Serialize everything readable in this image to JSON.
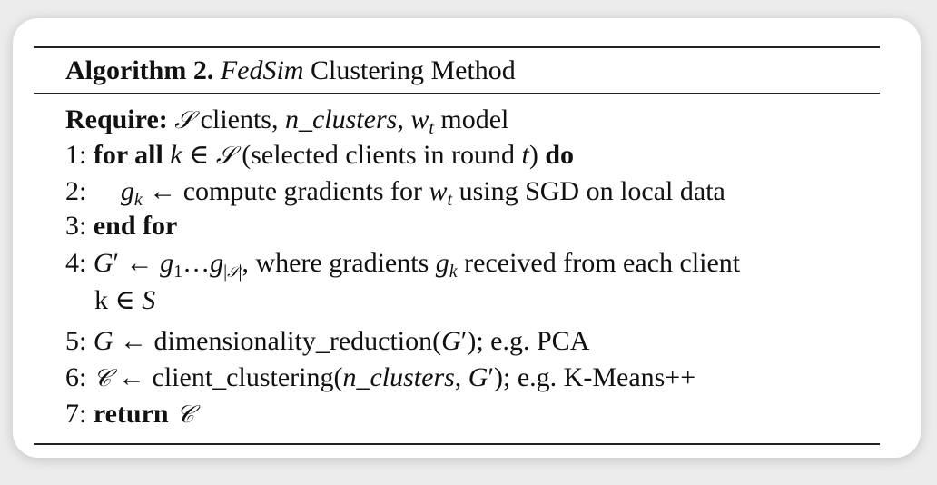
{
  "algorithm": {
    "label": "Algorithm 2.",
    "name": "FedSim",
    "title_rest": "Clustering Method"
  },
  "require": {
    "keyword": "Require:",
    "set_symbol": "𝒮",
    "text_clients": " clients, ",
    "param": "n_clusters",
    "comma": ", ",
    "w": "w",
    "w_sub": "t",
    "text_model": " model"
  },
  "lines": {
    "l1": {
      "num": "1: ",
      "kw_for": "for all",
      "k": " k ",
      "in": "∈ ",
      "set": "𝒮",
      "paren_open": " (selected clients in round ",
      "t": "t",
      "paren_close": ") ",
      "kw_do": "do"
    },
    "l2": {
      "num": "2: ",
      "g": "g",
      "g_sub": "k",
      "arrow_text": " ← compute gradients for ",
      "w": "w",
      "w_sub": "t",
      "rest": " using SGD on local data"
    },
    "l3": {
      "num": "3: ",
      "kw": "end for"
    },
    "l4": {
      "num": "4: ",
      "G": "G",
      "prime": "′",
      "arrow": " ← ",
      "g1": "g",
      "g1_sub": "1",
      "dots": "…",
      "g2": "g",
      "g2_sub_open": "|",
      "g2_sub_set": "𝒮",
      "g2_sub_close": "|",
      "mid": ", where gradients ",
      "gk": "g",
      "gk_sub": "k",
      "rest": " received from each client",
      "cont": "k ∈ ",
      "cont_S": "S"
    },
    "l5": {
      "num": "5: ",
      "G": "G",
      "text": " ← dimensionality_reduction(",
      "Gp": "G",
      "prime": "′",
      "rest": "); e.g. PCA"
    },
    "l6": {
      "num": "6: ",
      "C": "𝒞",
      "text": " ← client_clustering(",
      "param": "n_clusters",
      "comma": ", ",
      "Gp": "G",
      "prime": "′",
      "rest": "); e.g. K-Means++"
    },
    "l7": {
      "num": "7: ",
      "kw": "return",
      "C": " 𝒞"
    }
  }
}
